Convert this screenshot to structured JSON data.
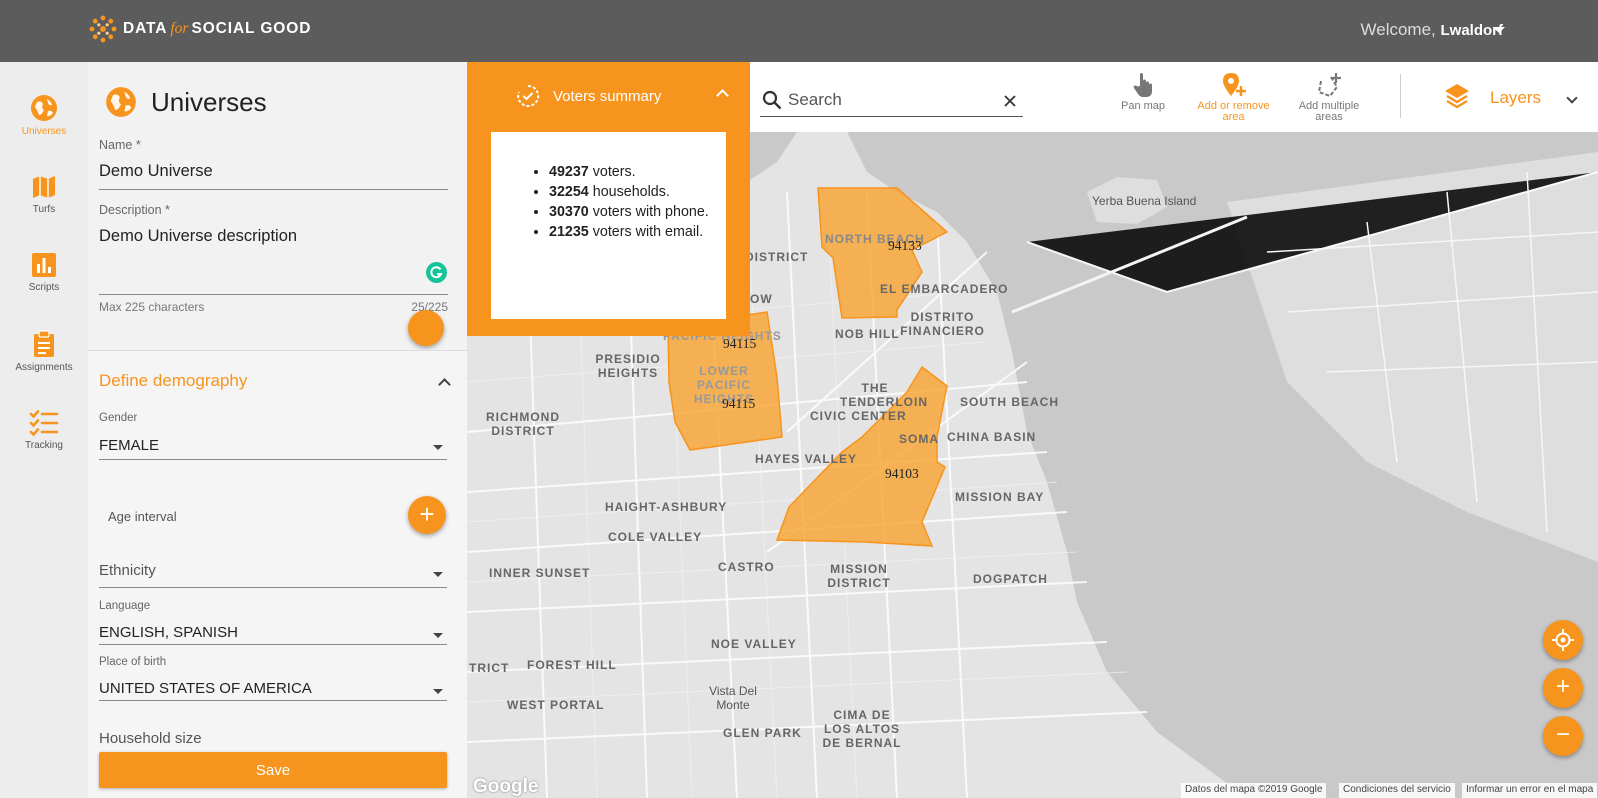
{
  "header": {
    "logo_word_1": "DATA",
    "logo_word_italic": "for",
    "logo_word_2": "SOCIAL GOOD",
    "welcome_prefix": "Welcome,",
    "username": "Lwaldorf"
  },
  "rail": {
    "items": [
      {
        "label": "Universes",
        "icon": "globe-icon",
        "active": true
      },
      {
        "label": "Turfs",
        "icon": "map-icon",
        "active": false
      },
      {
        "label": "Scripts",
        "icon": "bar-chart-icon",
        "active": false
      },
      {
        "label": "Assignments",
        "icon": "clipboard-icon",
        "active": false
      },
      {
        "label": "Tracking",
        "icon": "checklist-icon",
        "active": false
      }
    ]
  },
  "panel": {
    "title": "Universes",
    "name_label": "Name *",
    "name_value": "Demo Universe",
    "description_label": "Description *",
    "description_value": "Demo Universe description",
    "description_hint": "Max 225 characters",
    "description_count": "25/225",
    "demography": {
      "title": "Define demography",
      "gender_label": "Gender",
      "gender_value": "FEMALE",
      "age_label": "Age interval",
      "ethnicity_placeholder": "Ethnicity",
      "language_label": "Language",
      "language_value": "ENGLISH, SPANISH",
      "birth_label": "Place of birth",
      "birth_value": "UNITED STATES OF AMERICA",
      "household_placeholder": "Household size"
    },
    "save_label": "Save"
  },
  "summary": {
    "title": "Voters summary",
    "items": [
      {
        "count": "49237",
        "text": " voters."
      },
      {
        "count": "32254",
        "text": " households."
      },
      {
        "count": "30370",
        "text": " voters with phone."
      },
      {
        "count": "21235",
        "text": " voters with email."
      }
    ]
  },
  "toolbar": {
    "search_placeholder": "Search",
    "pan_label": "Pan map",
    "add_remove_line1": "Add or remove",
    "add_remove_line2": "area",
    "add_multiple_line1": "Add multiple",
    "add_multiple_line2": "areas",
    "layers_label": "Layers"
  },
  "map": {
    "accent": "#f7941d",
    "zip_labels": [
      "94133",
      "94115",
      "94115",
      "94103"
    ],
    "neighborhoods": [
      "Yerba Buena Island",
      "NORTH BEACH",
      "EL EMBARCADERO",
      "DISTRITO FINANCIERO",
      "NOB HILL",
      "PACIFIC HEIGHTS",
      "LOWER PACIFIC HEIGHTS",
      "PRESIDIO HEIGHTS",
      "RICHMOND DISTRICT",
      "THE TENDERLOIN",
      "CIVIC CENTER",
      "SOUTH BEACH",
      "SOMA",
      "CHINA BASIN",
      "HAYES VALLEY",
      "MISSION BAY",
      "HAIGHT-ASHBURY",
      "COLE VALLEY",
      "INNER SUNSET",
      "CASTRO",
      "MISSION DISTRICT",
      "DOGPATCH",
      "NOE VALLEY",
      "FOREST HILL",
      "Vista Del Monte",
      "WEST PORTAL",
      "GLEN PARK",
      "CIMA DE LOS ALTOS DE BERNAL",
      "DISTRICT",
      "TRICT",
      "OW"
    ],
    "google": "Google",
    "attribution": [
      "Datos del mapa ©2019 Google",
      "Condiciones del servicio",
      "Informar un error en el mapa"
    ]
  }
}
